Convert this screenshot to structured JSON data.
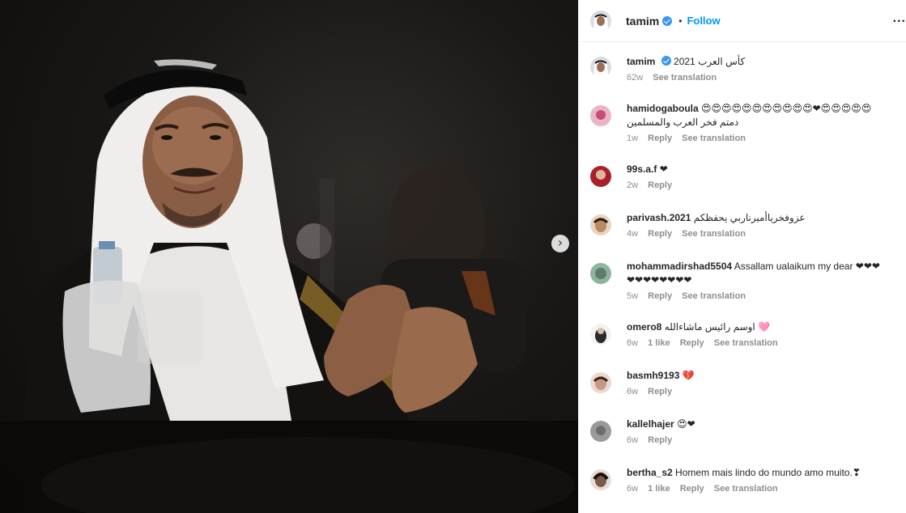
{
  "header": {
    "username": "tamim",
    "dot": "•",
    "follow_label": "Follow",
    "more_label": "..."
  },
  "media": {
    "next_arrow": "›"
  },
  "caption": {
    "username": "tamim",
    "text": "كأس العرب 2021",
    "time": "62w",
    "see_translation": "See translation"
  },
  "comments": [
    {
      "username": "hamidogaboula",
      "text": "😍😍😍😍😍😍😍😍😍😍😍❤😍😍😍😍😍",
      "text2": "دمتم فخر العرب والمسلمين",
      "time": "1w",
      "likes": "",
      "reply": "Reply",
      "see_translation": "See translation",
      "avatar_color": "#e9b6c6"
    },
    {
      "username": "99s.a.f",
      "text": "❤",
      "text2": "",
      "time": "2w",
      "likes": "",
      "reply": "Reply",
      "see_translation": "",
      "avatar_color": "#a8222c"
    },
    {
      "username": "parivash.2021",
      "text": "عزوفخرياأميرناربي يحفظكم",
      "text2": "",
      "time": "4w",
      "likes": "",
      "reply": "Reply",
      "see_translation": "See translation",
      "avatar_color": "#b88a5e"
    },
    {
      "username": "mohammadirshad5504",
      "text": "Assallam ualaikum my dear ❤❤❤",
      "text2": "❤❤❤❤❤❤❤❤",
      "time": "5w",
      "likes": "",
      "reply": "Reply",
      "see_translation": "See translation",
      "avatar_color": "#5c7d6a"
    },
    {
      "username": "omero8",
      "text": "اوسم رائيس ماشاءالله 🩷",
      "text2": "",
      "time": "6w",
      "likes": "1 like",
      "reply": "Reply",
      "see_translation": "See translation",
      "avatar_color": "#2b2b2b"
    },
    {
      "username": "basmh9193",
      "text": "💔",
      "text2": "",
      "time": "6w",
      "likes": "",
      "reply": "Reply",
      "see_translation": "",
      "avatar_color": "#c49a84"
    },
    {
      "username": "kallelhajer",
      "text": "😍❤",
      "text2": "",
      "time": "6w",
      "likes": "",
      "reply": "Reply",
      "see_translation": "",
      "avatar_color": "#6d6d6d"
    },
    {
      "username": "bertha_s2",
      "text": "Homem mais lindo do mundo amo muito.❣",
      "text2": "",
      "time": "6w",
      "likes": "1 like",
      "reply": "Reply",
      "see_translation": "See translation",
      "avatar_color": "#7a5a48"
    }
  ],
  "icons": {
    "verified": "verified-badge-icon",
    "next": "chevron-right-icon",
    "more": "more-options-icon"
  },
  "colors": {
    "follow": "#0095f6",
    "verified": "#3897f0",
    "meta": "#8e8e8e"
  }
}
